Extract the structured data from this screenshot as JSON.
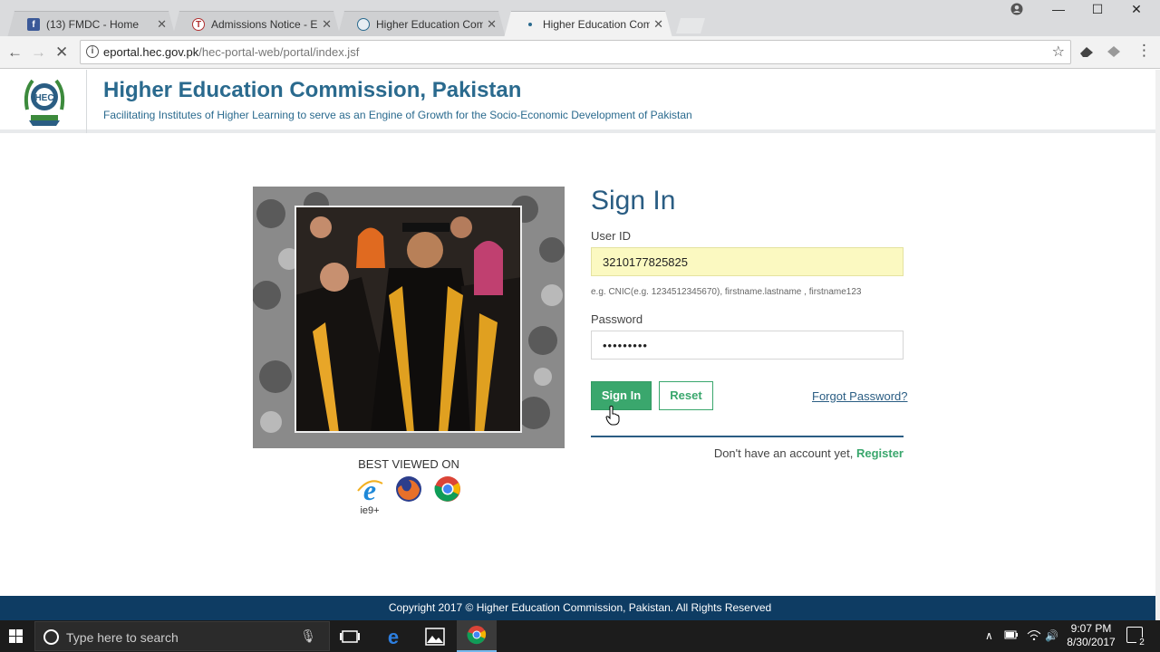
{
  "browser": {
    "tabs": [
      {
        "title": "(13) FMDC - Home",
        "favicon": "facebook-icon",
        "color": "#3b5998"
      },
      {
        "title": "Admissions Notice - Entr",
        "favicon": "university-icon",
        "color": "#b03030"
      },
      {
        "title": "Higher Education Comm",
        "favicon": "hec-icon",
        "color": "#2a6a8e"
      },
      {
        "title": "Higher Education Comm",
        "favicon": "loading-icon",
        "color": "#2a6a8e",
        "active": true
      }
    ],
    "url_domain": "eportal.hec.gov.pk",
    "url_path": "/hec-portal-web/portal/index.jsf"
  },
  "header": {
    "title": "Higher Education Commission, Pakistan",
    "subtitle": "Facilitating Institutes of Higher Learning to serve as an Engine of Growth for the Socio-Economic Development of Pakistan"
  },
  "best_viewed": {
    "label": "BEST VIEWED ON",
    "ie_note": "ie9+",
    "browsers": [
      "internet-explorer-icon",
      "firefox-icon",
      "chrome-icon"
    ]
  },
  "signin": {
    "title": "Sign In",
    "user_label": "User ID",
    "user_value": "3210177825825",
    "user_hint": "e.g. CNIC(e.g. 1234512345670), firstname.lastname , firstname123",
    "password_label": "Password",
    "password_value": "•••••••••",
    "signin_button": "Sign In",
    "reset_button": "Reset",
    "forgot_link": "Forgot Password?",
    "no_account": "Don't have an account yet,",
    "register_link": "Register"
  },
  "footer": {
    "copyright": "Copyright 2017 © Higher Education Commission, Pakistan. All Rights Reserved"
  },
  "taskbar": {
    "search_placeholder": "Type here to search",
    "time": "9:07 PM",
    "date": "8/30/2017",
    "notification_count": "2"
  },
  "colors": {
    "brand_blue": "#2a6a8e",
    "accent_green": "#3aa76d",
    "footer_navy": "#0e3c63",
    "autofill_yellow": "#fbf9c1"
  }
}
